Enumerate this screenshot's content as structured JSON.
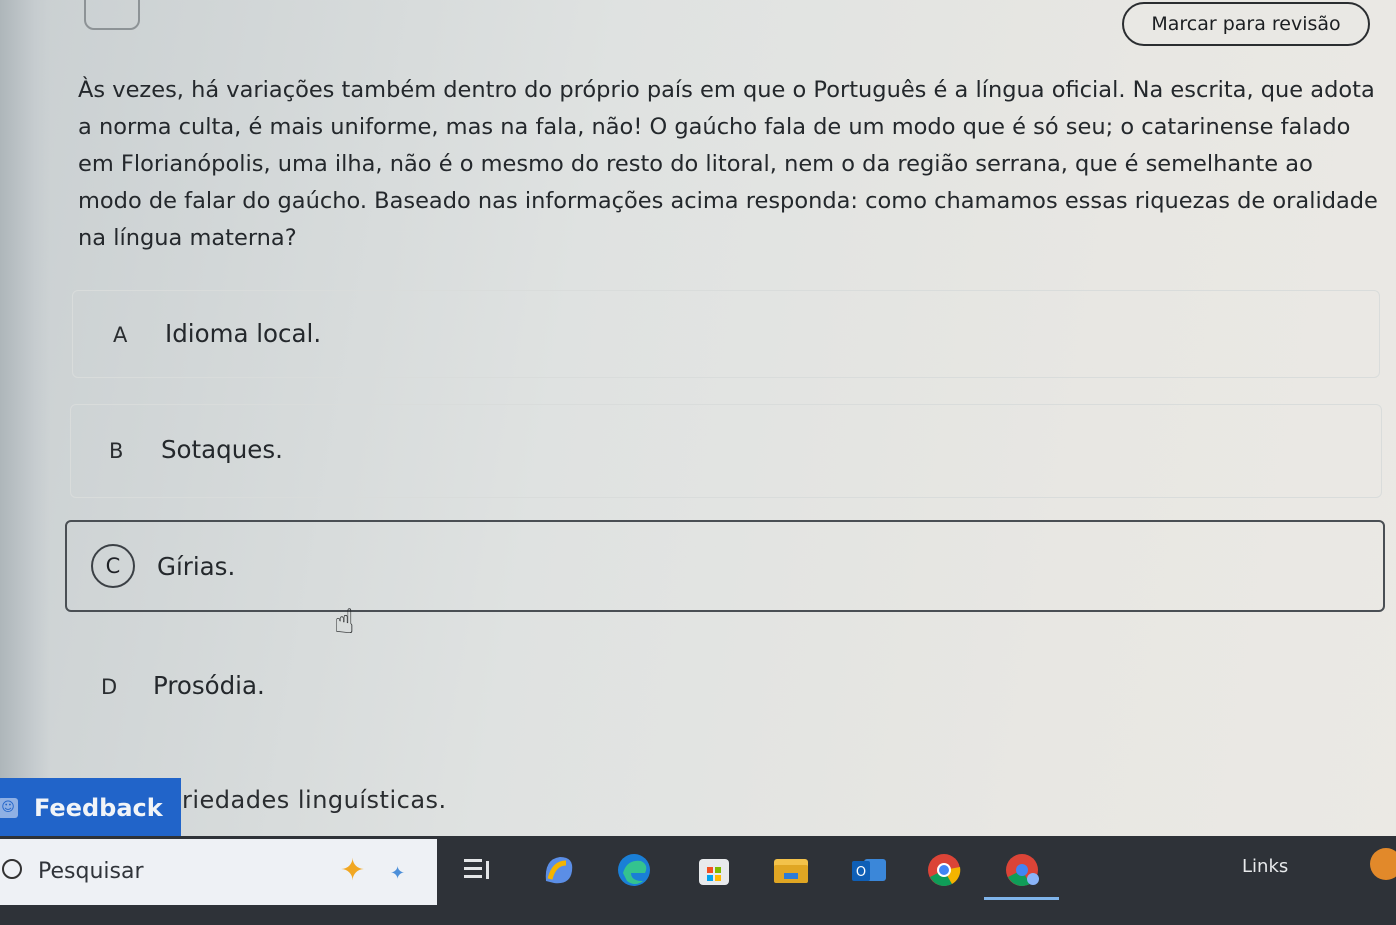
{
  "header": {
    "review_button": "Marcar para revisão"
  },
  "question": {
    "text": "Às vezes, há variações também dentro do próprio país em que o Português é a língua oficial. Na escrita, que adota a norma culta, é mais uniforme, mas na fala, não! O gaúcho fala de um modo que é só seu; o catarinense falado em Florianópolis, uma ilha, não é o mesmo do resto do litoral, nem o da região serrana, que é semelhante ao modo de falar do gaúcho. Baseado nas informações acima responda: como chamamos essas riquezas de oralidade na língua materna?"
  },
  "options": [
    {
      "letter": "A",
      "text": "Idioma local."
    },
    {
      "letter": "B",
      "text": "Sotaques."
    },
    {
      "letter": "C",
      "text": "Gírias."
    },
    {
      "letter": "D",
      "text": "Prosódia."
    }
  ],
  "option_e_partial": "riedades linguísticas.",
  "feedback": {
    "label": "Feedback"
  },
  "taskbar": {
    "search_label": "Pesquisar",
    "links_label": "Links",
    "apps": [
      "copilot-icon",
      "task-view-icon",
      "m365-icon",
      "edge-icon",
      "store-icon",
      "file-explorer-icon",
      "outlook-icon",
      "chrome-icon",
      "chrome-profile-icon"
    ]
  }
}
